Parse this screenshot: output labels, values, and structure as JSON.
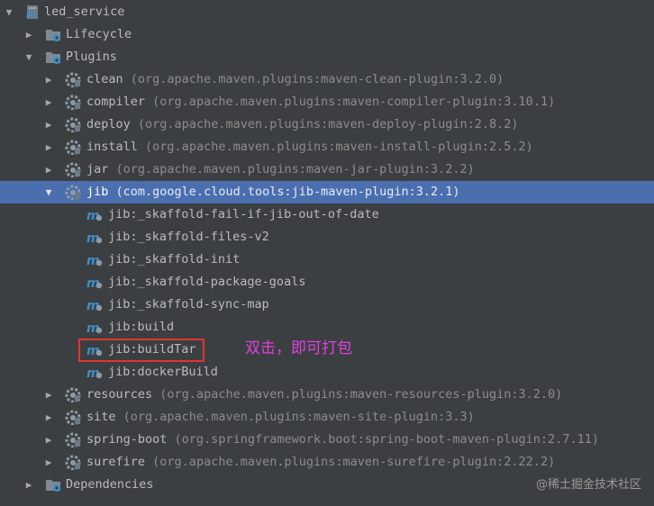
{
  "tree": {
    "project": "led_service",
    "lifecycle": "Lifecycle",
    "plugins_label": "Plugins",
    "plugins": [
      {
        "name": "clean",
        "coord": "(org.apache.maven.plugins:maven-clean-plugin:3.2.0)"
      },
      {
        "name": "compiler",
        "coord": "(org.apache.maven.plugins:maven-compiler-plugin:3.10.1)"
      },
      {
        "name": "deploy",
        "coord": "(org.apache.maven.plugins:maven-deploy-plugin:2.8.2)"
      },
      {
        "name": "install",
        "coord": "(org.apache.maven.plugins:maven-install-plugin:2.5.2)"
      },
      {
        "name": "jar",
        "coord": "(org.apache.maven.plugins:maven-jar-plugin:3.2.2)"
      },
      {
        "name": "jib",
        "coord": "(com.google.cloud.tools:jib-maven-plugin:3.2.1)"
      },
      {
        "name": "resources",
        "coord": "(org.apache.maven.plugins:maven-resources-plugin:3.2.0)"
      },
      {
        "name": "site",
        "coord": "(org.apache.maven.plugins:maven-site-plugin:3.3)"
      },
      {
        "name": "spring-boot",
        "coord": "(org.springframework.boot:spring-boot-maven-plugin:2.7.11)"
      },
      {
        "name": "surefire",
        "coord": "(org.apache.maven.plugins:maven-surefire-plugin:2.22.2)"
      }
    ],
    "jib_goals": [
      "jib:_skaffold-fail-if-jib-out-of-date",
      "jib:_skaffold-files-v2",
      "jib:_skaffold-init",
      "jib:_skaffold-package-goals",
      "jib:_skaffold-sync-map",
      "jib:build",
      "jib:buildTar",
      "jib:dockerBuild"
    ],
    "dependencies": "Dependencies"
  },
  "annotation": "双击，即可打包",
  "watermark": "@稀土掘金技术社区",
  "colors": {
    "background": "#3c3f41",
    "selection": "#4b6eaf",
    "highlight_box": "#e0352f",
    "annotation": "#e040e0"
  },
  "selected_plugin": "jib",
  "highlighted_goal": "jib:buildTar"
}
